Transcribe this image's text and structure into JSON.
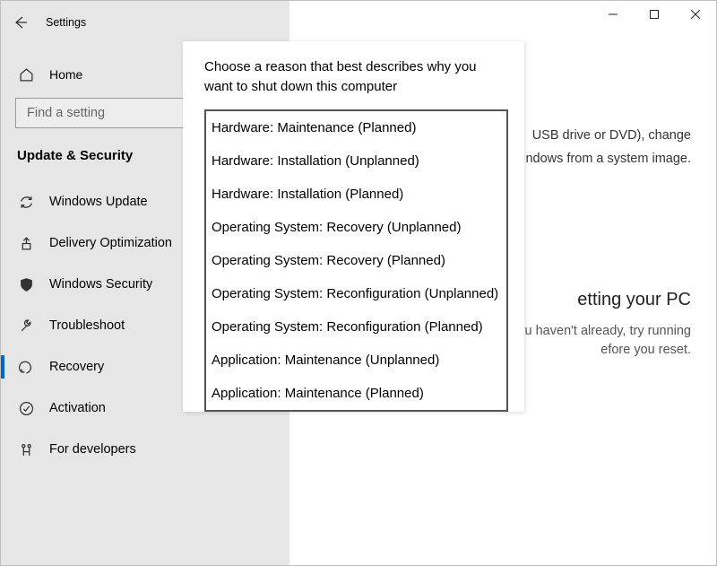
{
  "app": {
    "title": "Settings"
  },
  "home": {
    "label": "Home"
  },
  "search": {
    "placeholder": "Find a setting"
  },
  "section_title": "Update & Security",
  "nav": [
    {
      "label": "Windows Update"
    },
    {
      "label": "Delivery Optimization"
    },
    {
      "label": "Windows Security"
    },
    {
      "label": "Troubleshoot"
    },
    {
      "label": "Recovery"
    },
    {
      "label": "Activation"
    },
    {
      "label": "For developers"
    }
  ],
  "content": {
    "p1_right": "USB drive or DVD), change",
    "p2_right": "ndows from a system image.",
    "heading_partial": "etting your PC",
    "body_right_1": "f you haven't already, try running",
    "body_right_2": "efore you reset."
  },
  "popup": {
    "prompt": "Choose a reason that best describes why you want to shut down this computer",
    "options": [
      "Hardware: Maintenance (Planned)",
      "Hardware: Installation (Unplanned)",
      "Hardware: Installation (Planned)",
      "Operating System: Recovery (Unplanned)",
      "Operating System: Recovery (Planned)",
      "Operating System: Reconfiguration (Unplanned)",
      "Operating System: Reconfiguration (Planned)",
      "Application: Maintenance (Unplanned)",
      "Application: Maintenance (Planned)"
    ]
  }
}
